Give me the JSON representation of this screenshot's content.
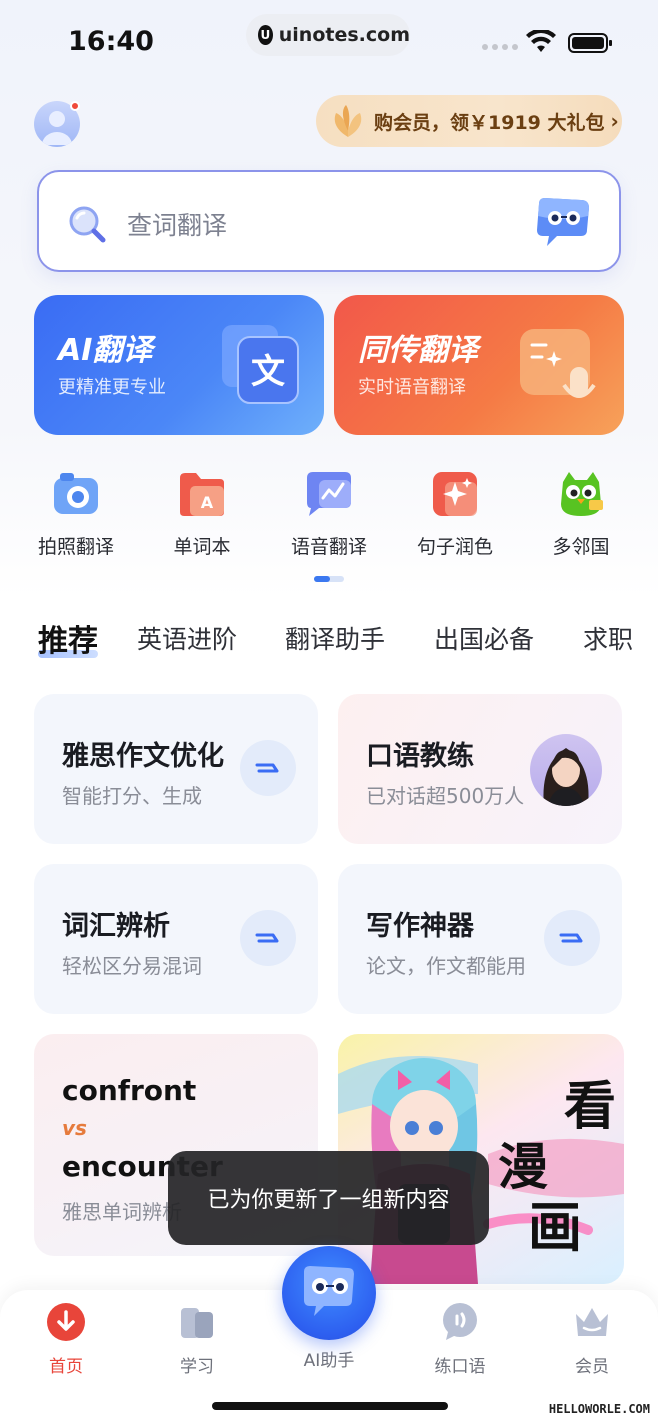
{
  "status_bar": {
    "time": "16:40",
    "url": "uinotes.com",
    "url_logo": "U"
  },
  "header": {
    "vip_banner": "购会员，领￥1919 大礼包",
    "vip_arrow": "›"
  },
  "search": {
    "placeholder": "查词翻译"
  },
  "features": [
    {
      "title": "AI翻译",
      "subtitle": "更精准更专业",
      "art_glyph": "文"
    },
    {
      "title": "同传翻译",
      "subtitle": "实时语音翻译"
    }
  ],
  "tools": [
    {
      "label": "拍照翻译",
      "icon": "camera-icon"
    },
    {
      "label": "单词本",
      "icon": "folder-icon"
    },
    {
      "label": "语音翻译",
      "icon": "chat-wave-icon"
    },
    {
      "label": "句子润色",
      "icon": "sparkle-icon"
    },
    {
      "label": "多邻国",
      "icon": "owl-icon"
    }
  ],
  "tabs": [
    "推荐",
    "英语进阶",
    "翻译助手",
    "出国必备",
    "求职"
  ],
  "cards": [
    {
      "title": "雅思作文优化",
      "subtitle": "智能打分、生成"
    },
    {
      "title": "口语教练",
      "subtitle": "已对话超500万人"
    },
    {
      "title": "词汇辨析",
      "subtitle": "轻松区分易混词"
    },
    {
      "title": "写作神器",
      "subtitle": "论文，作文都能用"
    }
  ],
  "word_card": {
    "word_a": "confront",
    "vs": "vs",
    "word_b": "encounter",
    "subtitle": "雅思单词辨析"
  },
  "comic_card": {
    "text": [
      "看",
      "漫",
      "画"
    ]
  },
  "toast": "已为你更新了一组新内容",
  "bottom_nav": [
    {
      "label": "首页",
      "active": true
    },
    {
      "label": "学习"
    },
    {
      "label": "AI助手"
    },
    {
      "label": "练口语"
    },
    {
      "label": "会员"
    }
  ],
  "watermark": "HELLOWORLE.COM",
  "colors": {
    "accent_blue": "#3a6cf4",
    "accent_orange": "#f2584a",
    "active_red": "#e8453a"
  }
}
